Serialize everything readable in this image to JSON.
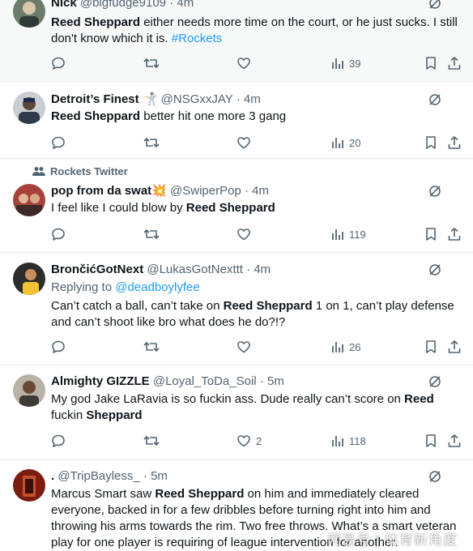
{
  "colors": {
    "link": "#1d9bf0",
    "muted": "#536471",
    "text": "#0f1419",
    "divider": "#e7e9ea"
  },
  "icons": {
    "reply": "reply-icon",
    "retweet": "retweet-icon",
    "like": "heart-icon",
    "views": "views-icon",
    "bookmark": "bookmark-icon",
    "share": "share-icon",
    "grok": "grok-icon"
  },
  "tweets": [
    {
      "name": "Nick",
      "handle": "@bigfudge9109",
      "time": "4m",
      "text_parts": [
        "Reed Sheppard",
        " either needs more time on the court, or he just sucks. I still don't know which it is. ",
        "#Rockets"
      ],
      "replies": "",
      "retweets": "",
      "likes": "",
      "views": "39"
    },
    {
      "name": "Detroit’s Finest 🤺",
      "handle": "@NSGxxJAY",
      "time": "4m",
      "text_parts": [
        "Reed Sheppard",
        " better hit one more 3 gang"
      ],
      "replies": "",
      "retweets": "",
      "likes": "",
      "views": "20"
    },
    {
      "social_context": "Rockets Twitter",
      "name": "pop from da swat💥",
      "handle": "@SwiperPop",
      "time": "4m",
      "text_parts": [
        "I feel like I could blow by ",
        "Reed Sheppard"
      ],
      "replies": "",
      "retweets": "",
      "likes": "",
      "views": "119"
    },
    {
      "name": "BrončićGotNext",
      "handle": "@LukasGotNexttt",
      "time": "4m",
      "replying_to_label": "Replying to",
      "replying_to": "@deadboylyfee",
      "text_parts": [
        "Can’t catch a ball, can’t take on ",
        "Reed Sheppard",
        " 1 on 1, can’t play defense and can’t shoot like bro what does he do?!?"
      ],
      "replies": "",
      "retweets": "",
      "likes": "",
      "views": "26"
    },
    {
      "name": "Almighty GIZZLE",
      "handle": "@Loyal_ToDa_Soil",
      "time": "5m",
      "text_parts": [
        "My god Jake LaRavia is so fuckin ass. Dude really can’t score on ",
        "Reed",
        " fuckin ",
        "Sheppard"
      ],
      "replies": "",
      "retweets": "",
      "likes": "2",
      "views": "118"
    },
    {
      "name": ".",
      "handle": "@TripBayless_",
      "time": "5m",
      "text_parts": [
        "Marcus Smart saw ",
        "Reed Sheppard",
        " on him and immediately cleared everyone, backed in for a few dribbles before turning right into him and throwing his arms towards the rim. Two free throws. What’s a smart veteran play for one player is requiring of league intervention for another."
      ]
    }
  ],
  "watermark": "网易号 | 体育新角度",
  "separator": "·"
}
